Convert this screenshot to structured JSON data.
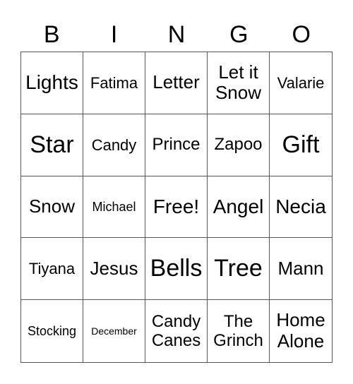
{
  "header": {
    "letters": [
      "B",
      "I",
      "N",
      "G",
      "O"
    ]
  },
  "grid": {
    "rows": [
      [
        "Lights",
        "Fatima",
        "Letter",
        "Let it Snow",
        "Valarie"
      ],
      [
        "Star",
        "Candy",
        "Prince",
        "Zapoo",
        "Gift"
      ],
      [
        "Snow",
        "Michael",
        "Free!",
        "Angel",
        "Necia"
      ],
      [
        "Tiyana",
        "Jesus",
        "Bells",
        "Tree",
        "Mann"
      ],
      [
        "Stocking",
        "December",
        "Candy Canes",
        "The Grinch",
        "Home Alone"
      ]
    ]
  }
}
